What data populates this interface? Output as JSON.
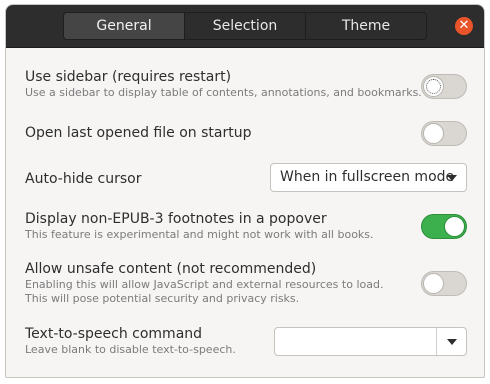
{
  "tabs": [
    {
      "label": "General",
      "active": true
    },
    {
      "label": "Selection",
      "active": false
    },
    {
      "label": "Theme",
      "active": false
    }
  ],
  "close_icon": "close-icon",
  "colors": {
    "titlebar": "#2d2d2d",
    "close_button": "#e9542a",
    "switch_on": "#3bb04c"
  },
  "settings": {
    "sidebar": {
      "label": "Use sidebar (requires restart)",
      "description": "Use a sidebar to display table of contents, annotations, and bookmarks.",
      "enabled": false
    },
    "open_last": {
      "label": "Open last opened file on startup",
      "enabled": false
    },
    "autohide": {
      "label": "Auto-hide cursor",
      "selected": "When in fullscreen mode"
    },
    "footnotes": {
      "label": "Display non-EPUB-3 footnotes in a popover",
      "description": "This feature is experimental and might not work with all books.",
      "enabled": true
    },
    "unsafe": {
      "label": "Allow unsafe content (not recommended)",
      "description_line1": "Enabling this will allow JavaScript and external resources to load.",
      "description_line2": "This will pose potential security and privacy risks.",
      "enabled": false
    },
    "tts": {
      "label": "Text-to-speech command",
      "description": "Leave blank to disable text-to-speech.",
      "value": ""
    }
  }
}
